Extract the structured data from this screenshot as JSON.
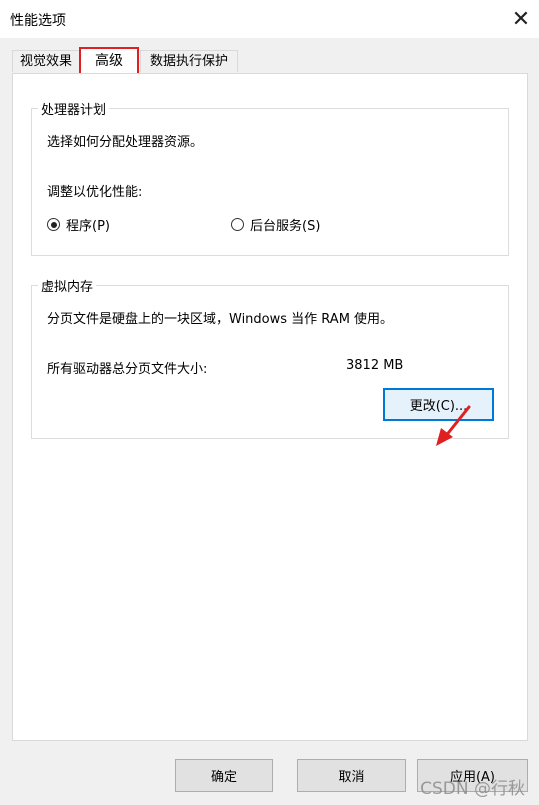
{
  "window": {
    "title": "性能选项",
    "close_label": "✕"
  },
  "tabs": [
    {
      "label": "视觉效果"
    },
    {
      "label": "高级",
      "selected": true
    },
    {
      "label": "数据执行保护"
    }
  ],
  "processor": {
    "legend": "处理器计划",
    "description": "选择如何分配处理器资源。",
    "adjust_label": "调整以优化性能:",
    "options": [
      {
        "label": "程序(P)",
        "checked": true
      },
      {
        "label": "后台服务(S)",
        "checked": false
      }
    ]
  },
  "virtual_memory": {
    "legend": "虚拟内存",
    "description": "分页文件是硬盘上的一块区域，Windows 当作 RAM 使用。",
    "total_label": "所有驱动器总分页文件大小:",
    "total_value": "3812 MB",
    "change_button": "更改(C)..."
  },
  "footer": {
    "ok": "确定",
    "cancel": "取消",
    "apply": "应用(A)"
  },
  "watermark": "CSDN @行秋",
  "colors": {
    "highlight": "#e02020",
    "focus": "#0078d7"
  }
}
